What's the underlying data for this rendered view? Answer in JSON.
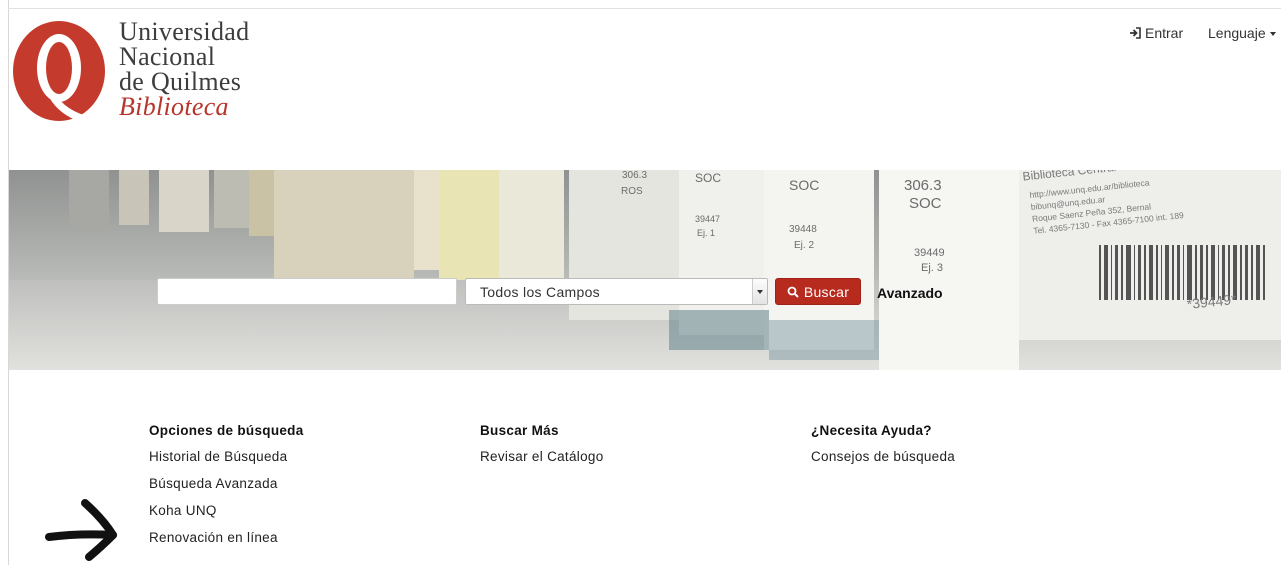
{
  "logo": {
    "line1": "Universidad",
    "line2": "Nacional",
    "line3": "de Quilmes",
    "line4": "Biblioteca",
    "mark_color": "#c43b2e"
  },
  "topnav": {
    "login_label": "Entrar",
    "login_icon": "sign-in-icon",
    "language_label": "Lenguaje"
  },
  "search": {
    "query_value": "",
    "field_selected": "Todos los Campos",
    "button_label": "Buscar",
    "advanced_label": "Avanzado",
    "accent_color": "#b72a1e"
  },
  "columns": [
    {
      "heading": "Opciones de búsqueda",
      "links": [
        "Historial de Búsqueda",
        "Búsqueda Avanzada",
        "Koha UNQ",
        "Renovación en línea"
      ]
    },
    {
      "heading": "Buscar Más",
      "links": [
        "Revisar el Catálogo"
      ]
    },
    {
      "heading": "¿Necesita Ayuda?",
      "links": [
        "Consejos de búsqueda"
      ]
    }
  ],
  "hero_labels": {
    "book1": [
      "306.3",
      "SOC",
      "39449",
      "Ej. 3"
    ],
    "book2": [
      "SOC",
      "39448",
      "Ej. 2"
    ],
    "book3": [
      "SOC",
      "39447",
      "Ej. 1"
    ],
    "book4": [
      "306.3",
      "ROS"
    ],
    "sticker": [
      "Biblioteca Central",
      "http://www.unq.edu.ar/biblioteca",
      "bibunq@unq.edu.ar",
      "Roque Saenz Peña 352, Bernal",
      "Tel. 4365-7130 - Fax 4365-7100 int. 189",
      "*39449*"
    ]
  }
}
